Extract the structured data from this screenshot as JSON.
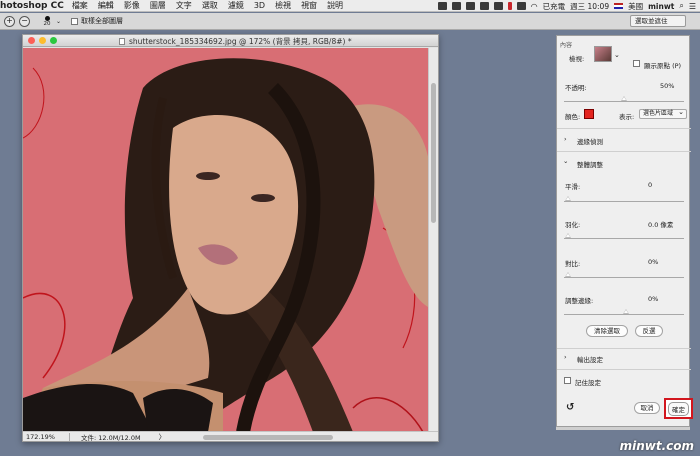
{
  "menubar": {
    "app": "hotoshop CC",
    "menus": [
      "檔案",
      "編輯",
      "影像",
      "圖層",
      "文字",
      "選取",
      "濾鏡",
      "3D",
      "檢視",
      "視窗",
      "說明"
    ],
    "battery": "已充電",
    "clock": "週三 10:09",
    "language": "美國",
    "user": "minwt"
  },
  "options_bar": {
    "brush_size": "20",
    "sample_all_layers": "取樣全部圖層",
    "select_mask_button": "選取並遮住"
  },
  "document": {
    "title": "shutterstock_185334692.jpg @ 172% (背景 拷貝, RGB/8#) *",
    "zoom": "172.19%",
    "doc_size": "文件: 12.0M/12.0M",
    "arrow": "〉"
  },
  "panel": {
    "properties_label": "內容",
    "view_label": "檢視:",
    "show_original": "顯示原點 (P)",
    "opacity_label": "不透明:",
    "opacity_value": "50%",
    "color_label": "顏色:",
    "show_label": "表示:",
    "show_value": "選色片區域",
    "color_hex": "#e3241f",
    "edge_detection": "邊緣偵測",
    "global_refinements": "整體調整",
    "smooth_label": "平滑:",
    "smooth_value": "0",
    "feather_label": "羽化:",
    "feather_value": "0.0 像素",
    "contrast_label": "對比:",
    "contrast_value": "0%",
    "shift_edge_label": "調整邊緣:",
    "shift_edge_value": "0%",
    "clear_selection": "清除選取",
    "invert": "反選",
    "output_settings": "輸出設定",
    "remember_settings": "記住設定",
    "cancel": "取消",
    "ok": "確定",
    "opacity_level": 0.5
  },
  "watermark": "minwt.com"
}
